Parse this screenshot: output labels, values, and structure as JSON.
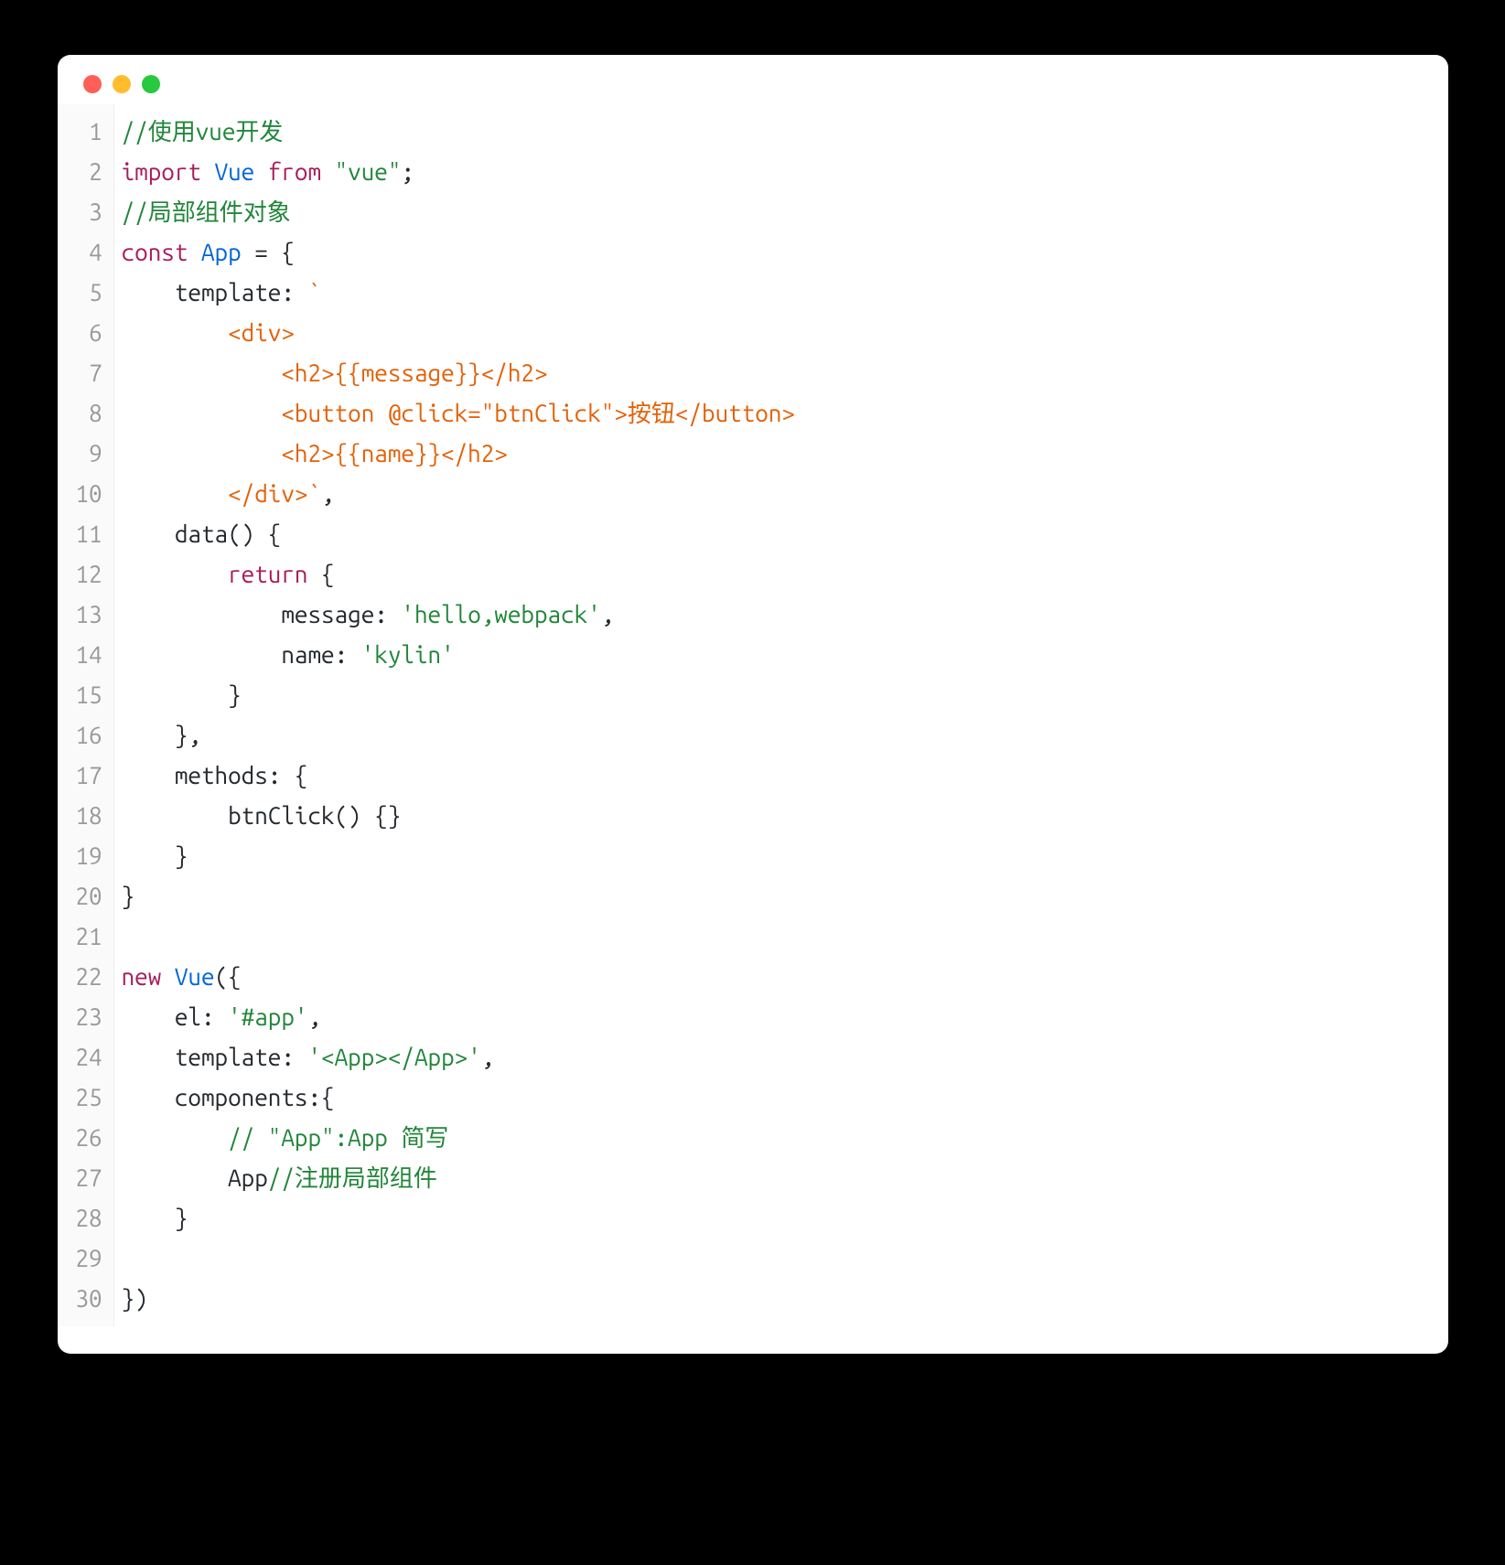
{
  "window": {
    "traffic_lights": [
      "red",
      "yellow",
      "green"
    ]
  },
  "code": {
    "line_numbers": [
      "1",
      "2",
      "3",
      "4",
      "5",
      "6",
      "7",
      "8",
      "9",
      "10",
      "11",
      "12",
      "13",
      "14",
      "15",
      "16",
      "17",
      "18",
      "19",
      "20",
      "21",
      "22",
      "23",
      "24",
      "25",
      "26",
      "27",
      "28",
      "29",
      "30"
    ],
    "tokens": {
      "l1_comment": "//使用vue开发",
      "l2_import": "import",
      "l2_vue": "Vue",
      "l2_from": "from",
      "l2_str": "\"vue\"",
      "l2_semi": ";",
      "l3_comment": "//局部组件对象",
      "l4_const": "const",
      "l4_app": "App",
      "l4_eq": " = {",
      "l5_template": "    template: ",
      "l5_tick": "`",
      "l6_div": "        <div>",
      "l7_h2": "            <h2>{{message}}</h2>",
      "l8_btn": "            <button @click=\"btnClick\">按钮</button>",
      "l9_h2": "            <h2>{{name}}</h2>",
      "l10_div": "        </div>",
      "l10_tick": "`",
      "l10_comma": ",",
      "l11_data": "    data() {",
      "l12_return": "return",
      "l12_brace": " {",
      "l12_pad": "        ",
      "l13_msg": "            message: ",
      "l13_msgv": "'hello,webpack'",
      "l13_comma": ",",
      "l14_name": "            name: ",
      "l14_namev": "'kylin'",
      "l15_close": "        }",
      "l16_close": "    },",
      "l17_methods": "    methods: {",
      "l18_btnclick": "        btnClick() {}",
      "l19_close": "    }",
      "l20_close": "}",
      "l21_blank": "",
      "l22_new": "new",
      "l22_vue": " Vue",
      "l22_paren": "({",
      "l23_el": "    el: ",
      "l23_elv": "'#app'",
      "l23_comma": ",",
      "l24_template": "    template: ",
      "l24_templatev": "'<App></App>'",
      "l24_comma": ",",
      "l25_components": "    components:{",
      "l26_pad": "        ",
      "l26_comment": "// \"App\":App 简写",
      "l27_app": "        App",
      "l27_comment": "//注册局部组件",
      "l28_close": "    }",
      "l29_blank": "",
      "l30_close": "})"
    }
  }
}
